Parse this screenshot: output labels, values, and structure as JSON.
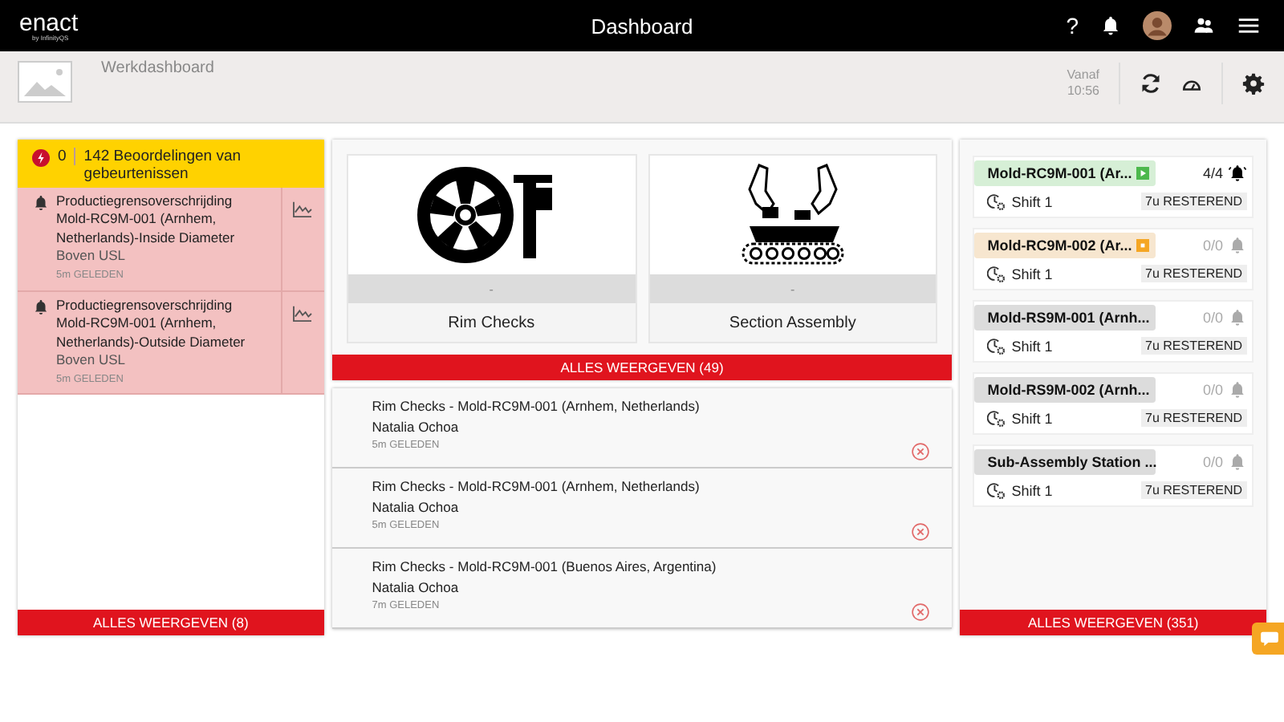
{
  "topbar": {
    "logo": "enact",
    "logo_sub": "by InfinityQS",
    "title": "Dashboard",
    "help": "?"
  },
  "subheader": {
    "title": "Werkdashboard",
    "since_label": "Vanaf",
    "since_time": "10:56"
  },
  "events": {
    "count": "0",
    "summary": "142 Beoordelingen van gebeurtenissen",
    "items": [
      {
        "title": "Productiegrensoverschrijding",
        "detail": "Mold-RC9M-001 (Arnhem, Netherlands)-Inside Diameter",
        "rule": "Boven USL",
        "time": "5m GELEDEN"
      },
      {
        "title": "Productiegrensoverschrijding",
        "detail": "Mold-RC9M-001 (Arnhem, Netherlands)-Outside Diameter",
        "rule": "Boven USL",
        "time": "5m GELEDEN"
      }
    ],
    "show_all": "ALLES WEERGEVEN (8)"
  },
  "checks": {
    "tiles": [
      {
        "kind": "wheel",
        "status": "-",
        "name": "Rim Checks"
      },
      {
        "kind": "assembly",
        "status": "-",
        "name": "Section Assembly"
      }
    ],
    "show_all": "ALLES WEERGEVEN (49)",
    "items": [
      {
        "title": "Rim Checks - Mold-RC9M-001 (Arnhem, Netherlands)",
        "user": "Natalia Ochoa",
        "time": "5m GELEDEN"
      },
      {
        "title": "Rim Checks - Mold-RC9M-001 (Arnhem, Netherlands)",
        "user": "Natalia Ochoa",
        "time": "5m GELEDEN"
      },
      {
        "title": "Rim Checks - Mold-RC9M-001 (Buenos Aires, Argentina)",
        "user": "Natalia Ochoa",
        "time": "7m GELEDEN"
      }
    ]
  },
  "stations": {
    "items": [
      {
        "name": "Mold-RC9M-001 (Ar...",
        "kind": "running",
        "alarms": "4/4",
        "alarm_active": true,
        "shift": "Shift 1",
        "remaining": "7u RESTEREND"
      },
      {
        "name": "Mold-RC9M-002 (Ar...",
        "kind": "paused",
        "alarms": "0/0",
        "alarm_active": false,
        "shift": "Shift 1",
        "remaining": "7u RESTEREND"
      },
      {
        "name": "Mold-RS9M-001 (Arnh...",
        "kind": "none",
        "alarms": "0/0",
        "alarm_active": false,
        "shift": "Shift 1",
        "remaining": "7u RESTEREND"
      },
      {
        "name": "Mold-RS9M-002 (Arnh...",
        "kind": "none",
        "alarms": "0/0",
        "alarm_active": false,
        "shift": "Shift 1",
        "remaining": "7u RESTEREND"
      },
      {
        "name": "Sub-Assembly Station ...",
        "kind": "none",
        "alarms": "0/0",
        "alarm_active": false,
        "shift": "Shift 1",
        "remaining": "7u RESTEREND"
      }
    ],
    "show_all": "ALLES WEERGEVEN (351)"
  }
}
